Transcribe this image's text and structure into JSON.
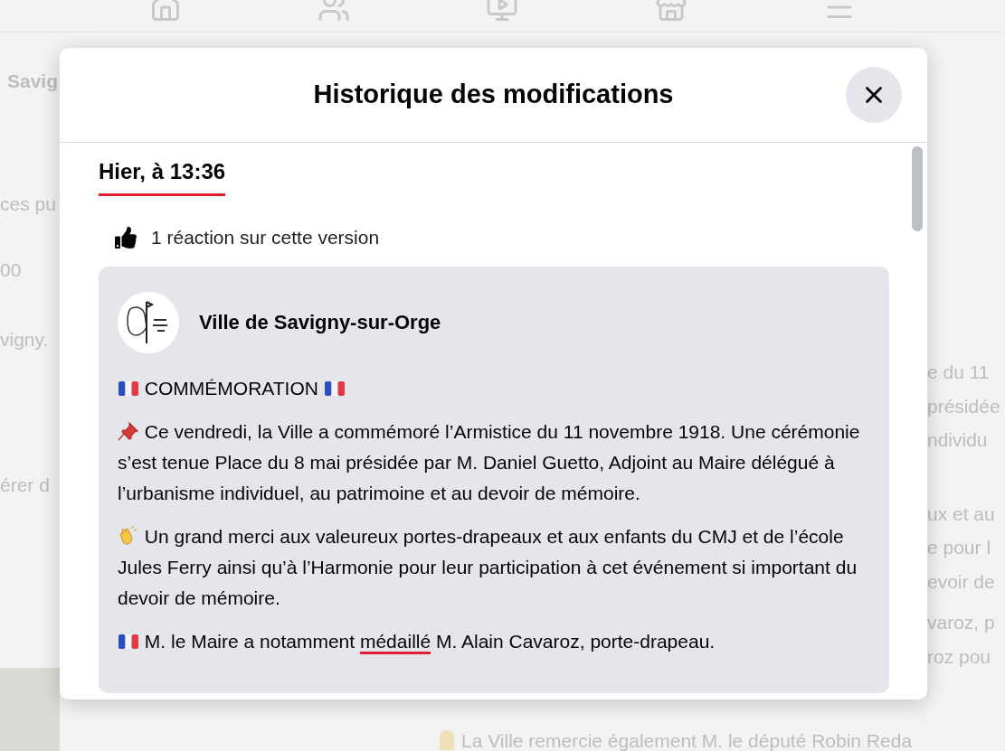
{
  "background": {
    "left_texts": [
      "Savig",
      "ces pu",
      "00",
      "vigny.",
      "érer d"
    ],
    "right_texts": [
      "e du 11",
      "présidée",
      "ndividu",
      "ux et au",
      "e pour l",
      "evoir de",
      "varoz, p",
      "roz pou"
    ],
    "bottom_text": "La Ville remercie également M. le député Robin Reda"
  },
  "dialog": {
    "title": "Historique des modifications",
    "version": {
      "date": {
        "text": "Hier, à 13:36",
        "marked": true
      },
      "reactions": "1 réaction sur cette version",
      "post": {
        "author": "Ville de Savigny-sur-Orge",
        "paragraphs": [
          {
            "kind": "heading",
            "segments": [
              {
                "text": "COMMÉMORATION",
                "marked": false
              }
            ]
          },
          {
            "kind": "pin",
            "segments": [
              {
                "text": "Ce vendredi, la Ville a commémoré l’Armistice du 11 novembre 1918. Une cérémonie s’est tenue Place du 8 mai présidée par M. Daniel Guetto, Adjoint au Maire délégué à l’urbanisme individuel, au patrimoine et au devoir de mémoire.",
                "marked": false
              }
            ]
          },
          {
            "kind": "clap",
            "segments": [
              {
                "text": "Un grand merci aux valeureux portes-drapeaux et aux enfants du CMJ et de l’école Jules Ferry ainsi qu’à l’Harmonie pour leur participation à cet événement si important du devoir de mémoire.",
                "marked": false
              }
            ]
          },
          {
            "kind": "flag",
            "segments": [
              {
                "text": "M. le Maire a notamment ",
                "marked": false
              },
              {
                "text": "médaillé",
                "marked": true
              },
              {
                "text": " M. Alain Cavaroz, porte-drapeau.",
                "marked": false
              }
            ]
          }
        ]
      }
    }
  }
}
